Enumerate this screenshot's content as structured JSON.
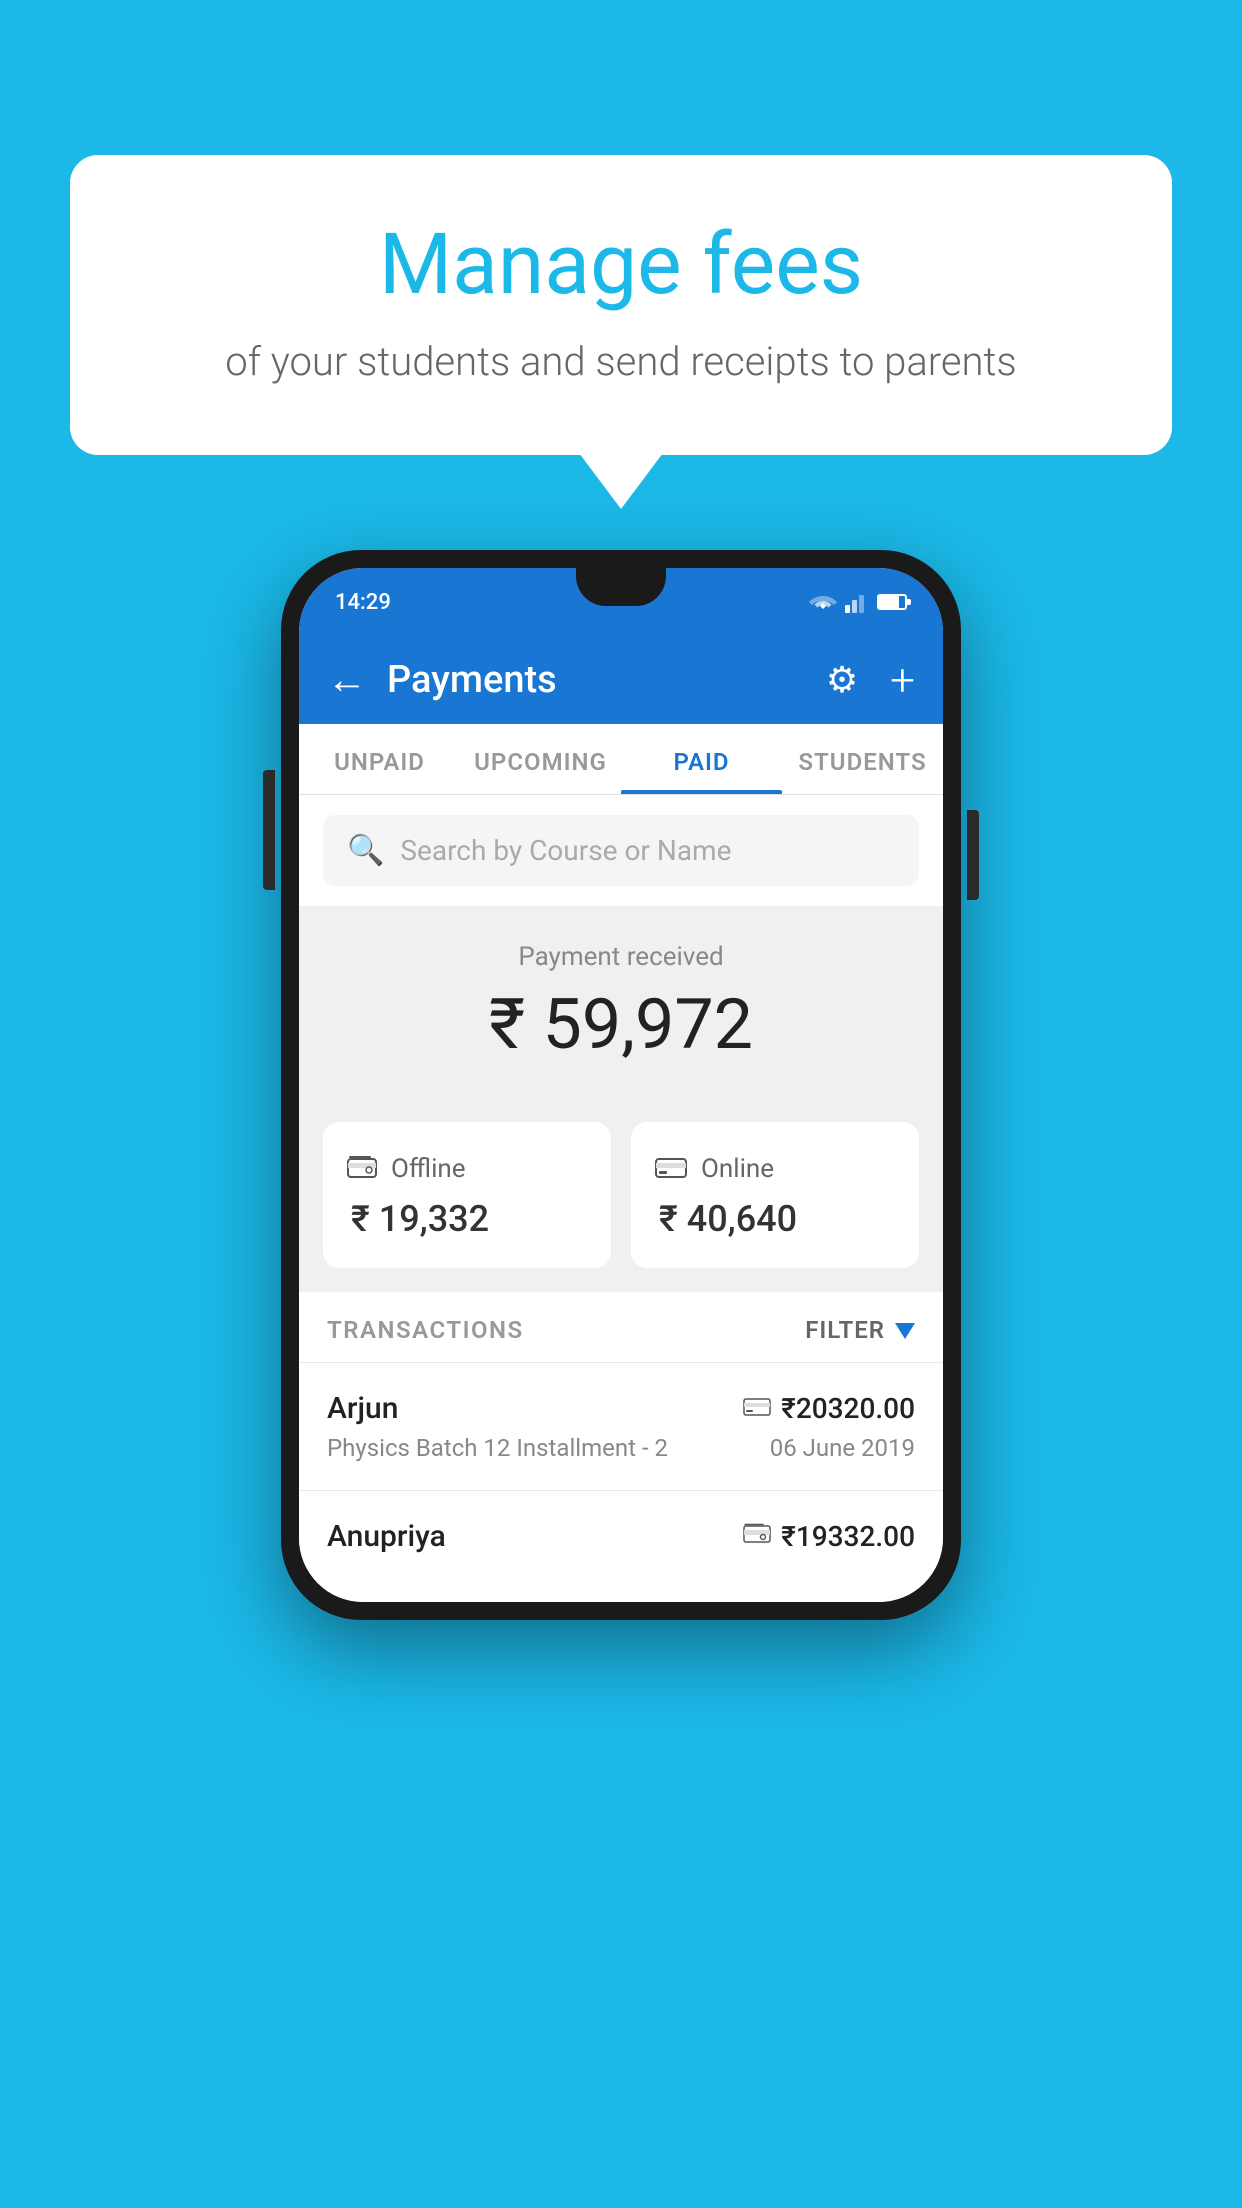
{
  "background_color": "#1BB8E8",
  "bubble": {
    "heading": "Manage fees",
    "subtext": "of your students and send receipts to parents"
  },
  "status_bar": {
    "time": "14:29"
  },
  "header": {
    "title": "Payments",
    "back_label": "←",
    "settings_label": "⚙",
    "add_label": "+"
  },
  "tabs": [
    {
      "id": "unpaid",
      "label": "UNPAID",
      "active": false
    },
    {
      "id": "upcoming",
      "label": "UPCOMING",
      "active": false
    },
    {
      "id": "paid",
      "label": "PAID",
      "active": true
    },
    {
      "id": "students",
      "label": "STUDENTS",
      "active": false
    }
  ],
  "search": {
    "placeholder": "Search by Course or Name"
  },
  "payment_summary": {
    "label": "Payment received",
    "total": "₹ 59,972",
    "offline_label": "Offline",
    "offline_amount": "₹ 19,332",
    "online_label": "Online",
    "online_amount": "₹ 40,640"
  },
  "transactions": {
    "section_label": "TRANSACTIONS",
    "filter_label": "FILTER",
    "rows": [
      {
        "name": "Arjun",
        "course": "Physics Batch 12 Installment - 2",
        "amount": "₹20320.00",
        "date": "06 June 2019",
        "payment_type": "card"
      },
      {
        "name": "Anupriya",
        "course": "",
        "amount": "₹19332.00",
        "date": "",
        "payment_type": "cash"
      }
    ]
  }
}
